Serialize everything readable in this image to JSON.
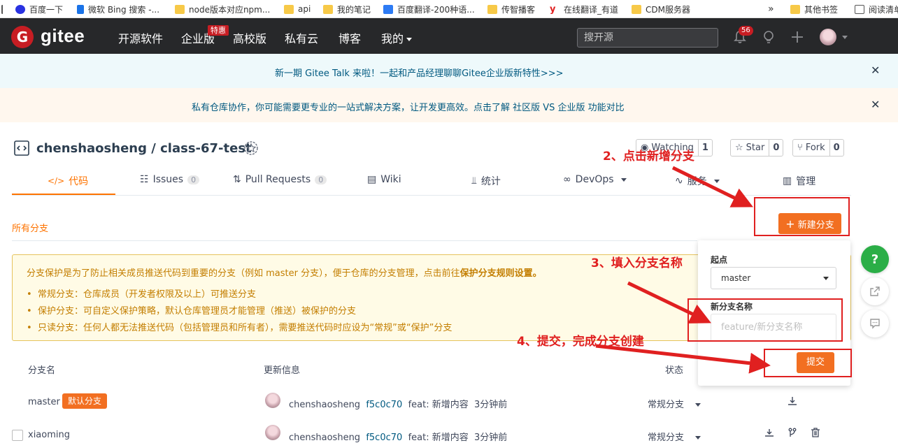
{
  "bookmarks": [
    {
      "label": "",
      "icon": "app-grid-icon"
    },
    {
      "label": "百度一下",
      "icon": "baidu-icon"
    },
    {
      "label": "微软 Bing 搜索 -...",
      "icon": "bing-icon"
    },
    {
      "label": "node版本对应npm...",
      "icon": "folder-icon"
    },
    {
      "label": "api",
      "icon": "folder-icon"
    },
    {
      "label": "我的笔记",
      "icon": "folder-icon"
    },
    {
      "label": "百度翻译-200种语...",
      "icon": "translate-icon"
    },
    {
      "label": "传智播客",
      "icon": "folder-icon"
    },
    {
      "label": "在线翻译_有道",
      "icon": "youdao-icon"
    },
    {
      "label": "CDM服务器",
      "icon": "folder-icon"
    },
    {
      "label": "»",
      "icon": ""
    },
    {
      "label": "其他书签",
      "icon": "folder-icon"
    },
    {
      "label": "阅读清单",
      "icon": "reading-list-icon"
    }
  ],
  "topnav": {
    "logo": "gitee",
    "links": [
      "开源软件",
      "企业版",
      "高校版",
      "私有云",
      "博客",
      "我的"
    ],
    "hot_badge": "特惠",
    "search_placeholder": "搜开源",
    "notification_count": "56"
  },
  "banners": {
    "talk": "新一期 Gitee Talk 来啦！一起和产品经理聊聊Gitee企业版新特性>>>",
    "private": "私有仓库协作，你可能需要更专业的一站式解决方案，让开发更高效。点击了解 社区版 VS 企业版 功能对比"
  },
  "repo": {
    "owner": "chenshaosheng",
    "separator": "/",
    "name": "class-67-test",
    "watch_label": "Watching",
    "watch_count": "1",
    "star_label": "Star",
    "star_count": "0",
    "fork_label": "Fork",
    "fork_count": "0"
  },
  "tabs": [
    {
      "label": "代码",
      "count": ""
    },
    {
      "label": "Issues",
      "count": "0"
    },
    {
      "label": "Pull Requests",
      "count": "0"
    },
    {
      "label": "Wiki",
      "count": ""
    },
    {
      "label": "统计",
      "count": ""
    },
    {
      "label": "DevOps",
      "count": ""
    },
    {
      "label": "服务",
      "count": ""
    },
    {
      "label": "管理",
      "count": ""
    }
  ],
  "branches_section": {
    "title": "所有分支",
    "new_branch_label": "新建分支"
  },
  "notice": {
    "intro": "分支保护是为了防止相关成员推送代码到重要的分支（例如 master 分支），便于仓库的分支管理，点击前往",
    "intro_link": "保护分支规则设置。",
    "items": [
      "常规分支：仓库成员（开发者权限及以上）可推送分支",
      "保护分支：可自定义保护策略，默认仓库管理员才能管理（推送）被保护的分支",
      "只读分支：任何人都无法推送代码（包括管理员和所有者），需要推送代码时应设为“常规”或“保护”分支"
    ]
  },
  "table": {
    "headers": [
      "分支名",
      "更新信息",
      "状态"
    ],
    "rows": [
      {
        "branch": "master",
        "tag": "默认分支",
        "author": "chenshaosheng",
        "hash": "f5c0c70",
        "message": "feat: 新增内容",
        "time": "3分钟前",
        "status": "常规分支"
      },
      {
        "branch": "xiaoming",
        "tag": "",
        "author": "chenshaosheng",
        "hash": "f5c0c70",
        "message": "feat: 新增内容",
        "time": "3分钟前",
        "status": "常规分支"
      }
    ]
  },
  "popover": {
    "start_label": "起点",
    "start_value": "master",
    "name_label": "新分支名称",
    "name_placeholder": "feature/新分支名称",
    "submit_label": "提交"
  },
  "annotations": {
    "step2": "2、点击新增分支",
    "step3": "3、填入分支名称",
    "step4": "4、提交，完成分支创建"
  },
  "colors": {
    "brand_red": "#c71d23",
    "accent_orange": "#f26f21",
    "nav_bg": "#27282a",
    "annotation_red": "#e02020"
  }
}
